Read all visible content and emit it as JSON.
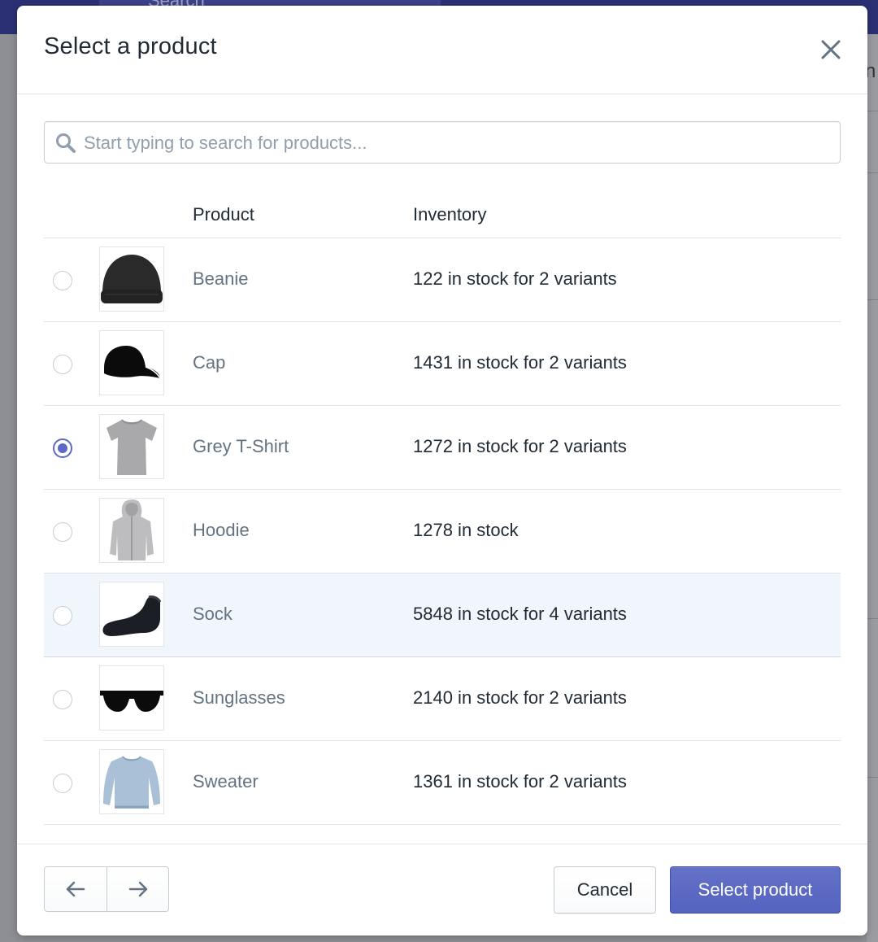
{
  "background": {
    "search_placeholder": "Search"
  },
  "modal": {
    "title": "Select a product",
    "search": {
      "placeholder": "Start typing to search for products...",
      "value": ""
    },
    "table": {
      "columns": [
        "",
        "",
        "Product",
        "Inventory"
      ],
      "rows": [
        {
          "name": "Beanie",
          "inventory": "122 in stock for 2 variants",
          "selected": false,
          "image_icon": "beanie-icon"
        },
        {
          "name": "Cap",
          "inventory": "1431 in stock for 2 variants",
          "selected": false,
          "image_icon": "cap-icon"
        },
        {
          "name": "Grey T-Shirt",
          "inventory": "1272 in stock for 2 variants",
          "selected": true,
          "image_icon": "tshirt-icon"
        },
        {
          "name": "Hoodie",
          "inventory": "1278 in stock",
          "selected": false,
          "image_icon": "hoodie-icon"
        },
        {
          "name": "Sock",
          "inventory": "5848 in stock for 4 variants",
          "selected": false,
          "hovered": true,
          "image_icon": "sock-icon"
        },
        {
          "name": "Sunglasses",
          "inventory": "2140 in stock for 2 variants",
          "selected": false,
          "image_icon": "sunglasses-icon"
        },
        {
          "name": "Sweater",
          "inventory": "1361 in stock for 2 variants",
          "selected": false,
          "image_icon": "sweater-icon"
        }
      ]
    },
    "footer": {
      "prev_icon": "arrow-left-icon",
      "next_icon": "arrow-right-icon",
      "cancel_label": "Cancel",
      "primary_label": "Select product"
    }
  },
  "colors": {
    "accent": "#5c6ac4",
    "link_text": "#637381",
    "hover_row": "#f0f6fc",
    "overlay_topbar": "#2b3075"
  }
}
